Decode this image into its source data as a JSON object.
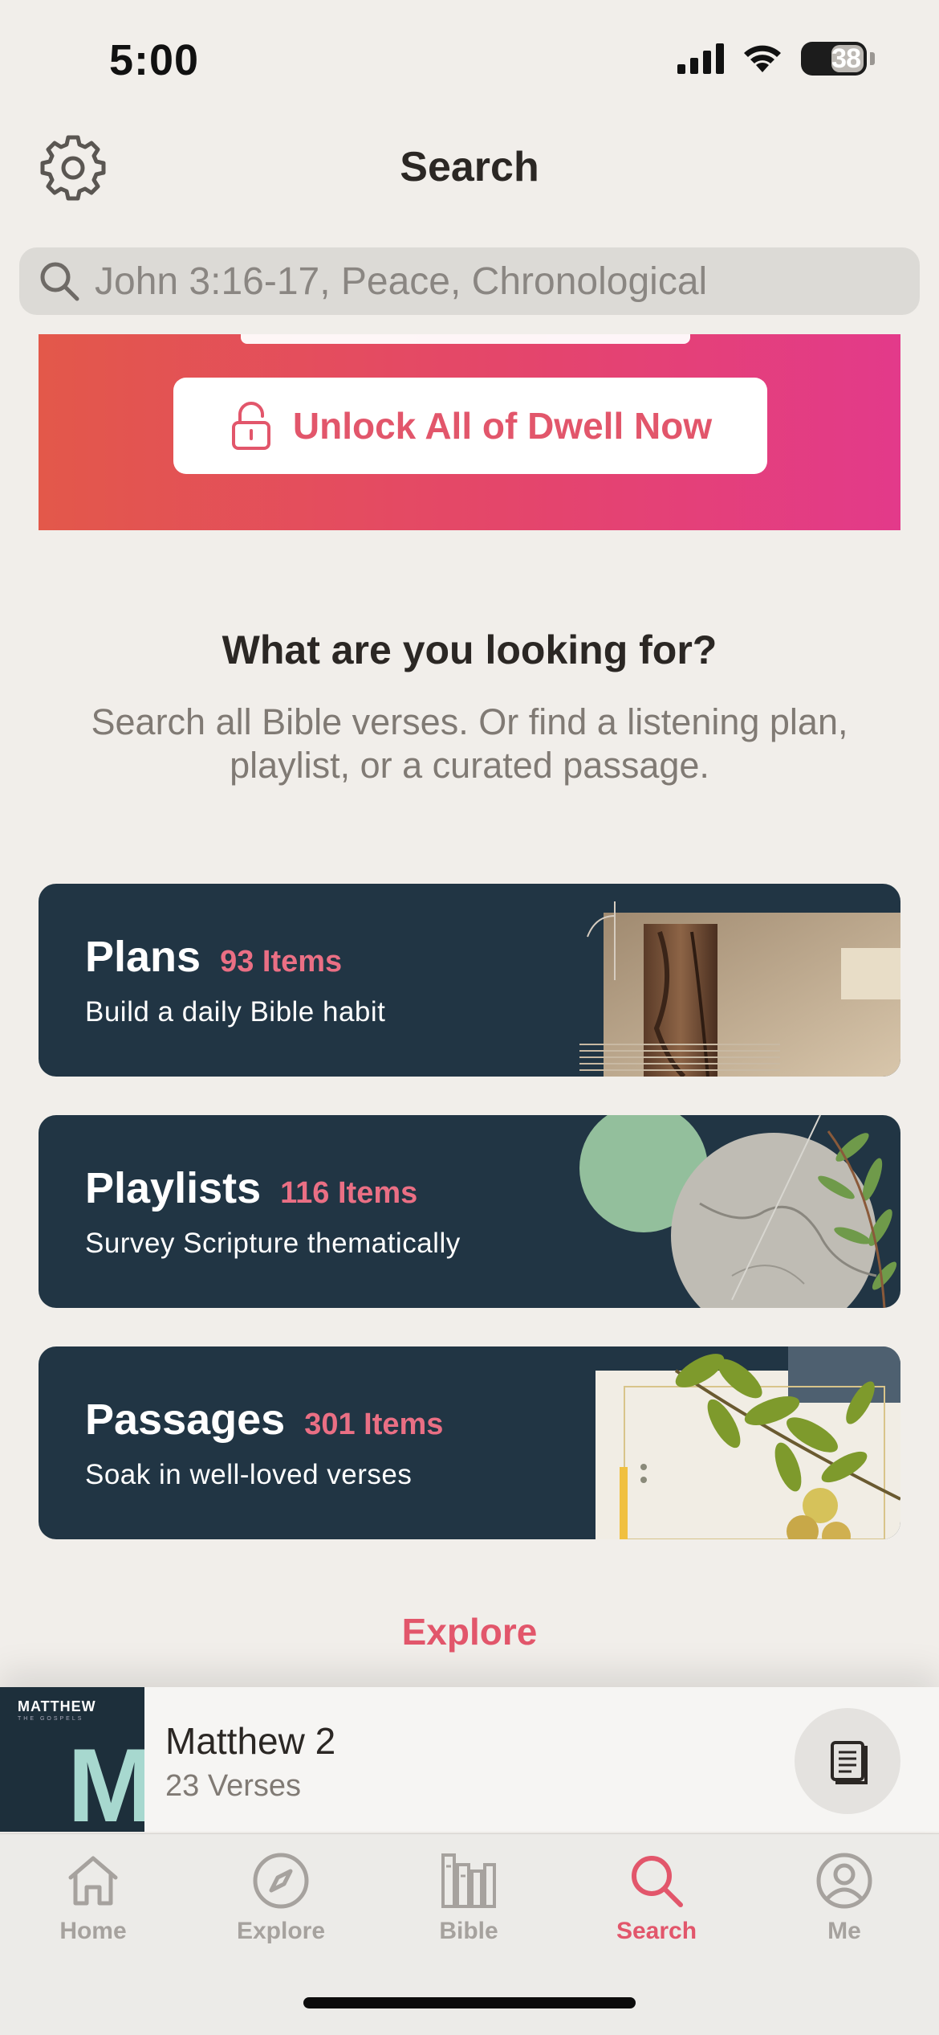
{
  "status_bar": {
    "time": "5:00",
    "battery": "38"
  },
  "header": {
    "title": "Search"
  },
  "search": {
    "placeholder": "John 3:16-17, Peace, Chronological"
  },
  "promo": {
    "button_label": "Unlock All of Dwell Now"
  },
  "prompt": {
    "title": "What are you looking for?",
    "subtitle": "Search all Bible verses. Or find a listening plan, playlist, or a curated passage."
  },
  "categories": [
    {
      "name": "Plans",
      "count": "93 Items",
      "description": "Build a daily Bible habit"
    },
    {
      "name": "Playlists",
      "count": "116 Items",
      "description": "Survey Scripture thematically"
    },
    {
      "name": "Passages",
      "count": "301 Items",
      "description": "Soak in well-loved verses"
    }
  ],
  "explore_label": "Explore",
  "now_playing": {
    "cover_title": "MATTHEW",
    "cover_subtitle": "THE GOSPELS",
    "cover_letter": "M",
    "title": "Matthew 2",
    "subtitle": "23 Verses"
  },
  "tabs": [
    {
      "label": "Home",
      "icon": "home-icon"
    },
    {
      "label": "Explore",
      "icon": "compass-icon"
    },
    {
      "label": "Bible",
      "icon": "books-icon"
    },
    {
      "label": "Search",
      "icon": "search-icon",
      "active": true
    },
    {
      "label": "Me",
      "icon": "profile-icon"
    }
  ],
  "colors": {
    "accent": "#e2566b",
    "card_bg": "#213544",
    "page_bg": "#f1eeea"
  }
}
